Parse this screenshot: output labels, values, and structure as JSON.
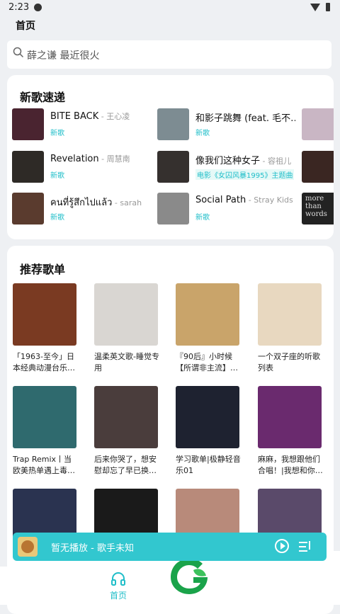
{
  "status": {
    "time": "2:23"
  },
  "header": {
    "title": "首页"
  },
  "search": {
    "placeholder": "薛之谦 最近很火"
  },
  "new_songs": {
    "title": "新歌速递",
    "items": [
      {
        "title": "BITE BACK",
        "artist": "王心凌",
        "tag": "新歌",
        "cover": "#4a2430"
      },
      {
        "title": "和影子跳舞 (feat. 毛不…",
        "artist": "",
        "tag": "新歌",
        "cover": "#7d8c92"
      },
      {
        "title": "Revelation",
        "artist": "周慧南",
        "tag": "新歌",
        "cover": "#2e2a26"
      },
      {
        "title": "像我们这种女子",
        "artist": "容祖儿",
        "tag": "电影《女囚风暴1995》主题曲",
        "cover": "#35302e"
      },
      {
        "title": "คนที่รู้สึกไปแล้ว",
        "artist": "sarah",
        "tag": "新歌",
        "cover": "#5a3b2e"
      },
      {
        "title": "Social Path",
        "artist": "Stray Kids",
        "tag": "新歌",
        "cover": "#8a8a8a"
      }
    ],
    "partial_covers": [
      {
        "cover": "#c9b6c4"
      },
      {
        "cover": "#3a2622"
      },
      {
        "cover": "#222222",
        "text": "more than words"
      }
    ]
  },
  "playlists": {
    "title": "推荐歌单",
    "items": [
      {
        "title": "「1963-至今」日本经典动漫台乐…",
        "cover": "#7a3a22"
      },
      {
        "title": "温柔英文歌-睡觉专用",
        "cover": "#d9d6d2"
      },
      {
        "title": "『90后』小时候【所谓非主流】…",
        "cover": "#c9a46a"
      },
      {
        "title": "一个双子座的听歌列表",
        "cover": "#e8d8c0"
      },
      {
        "title": "Trap Remix丨当欧美热单遇上毒性…",
        "cover": "#2f6a6e"
      },
      {
        "title": "后来你哭了，想安慰却忘了早已换…",
        "cover": "#4a3d3c"
      },
      {
        "title": "学习歌单|极静轻音乐01",
        "cover": "#1e2230"
      },
      {
        "title": "麻麻，我想跟他们合唱！|我想和你…",
        "cover": "#6a2a6e"
      },
      {
        "title": "",
        "cover": "#2a3350"
      },
      {
        "title": "",
        "cover": "#1a1a1a"
      },
      {
        "title": "",
        "cover": "#b88a7a"
      },
      {
        "title": "",
        "cover": "#5a4a6a"
      }
    ]
  },
  "mini_player": {
    "text": "暂无播放 - 歌手未知",
    "accent": "#32c7cf"
  },
  "bottom_nav": {
    "home_label": "首页"
  }
}
